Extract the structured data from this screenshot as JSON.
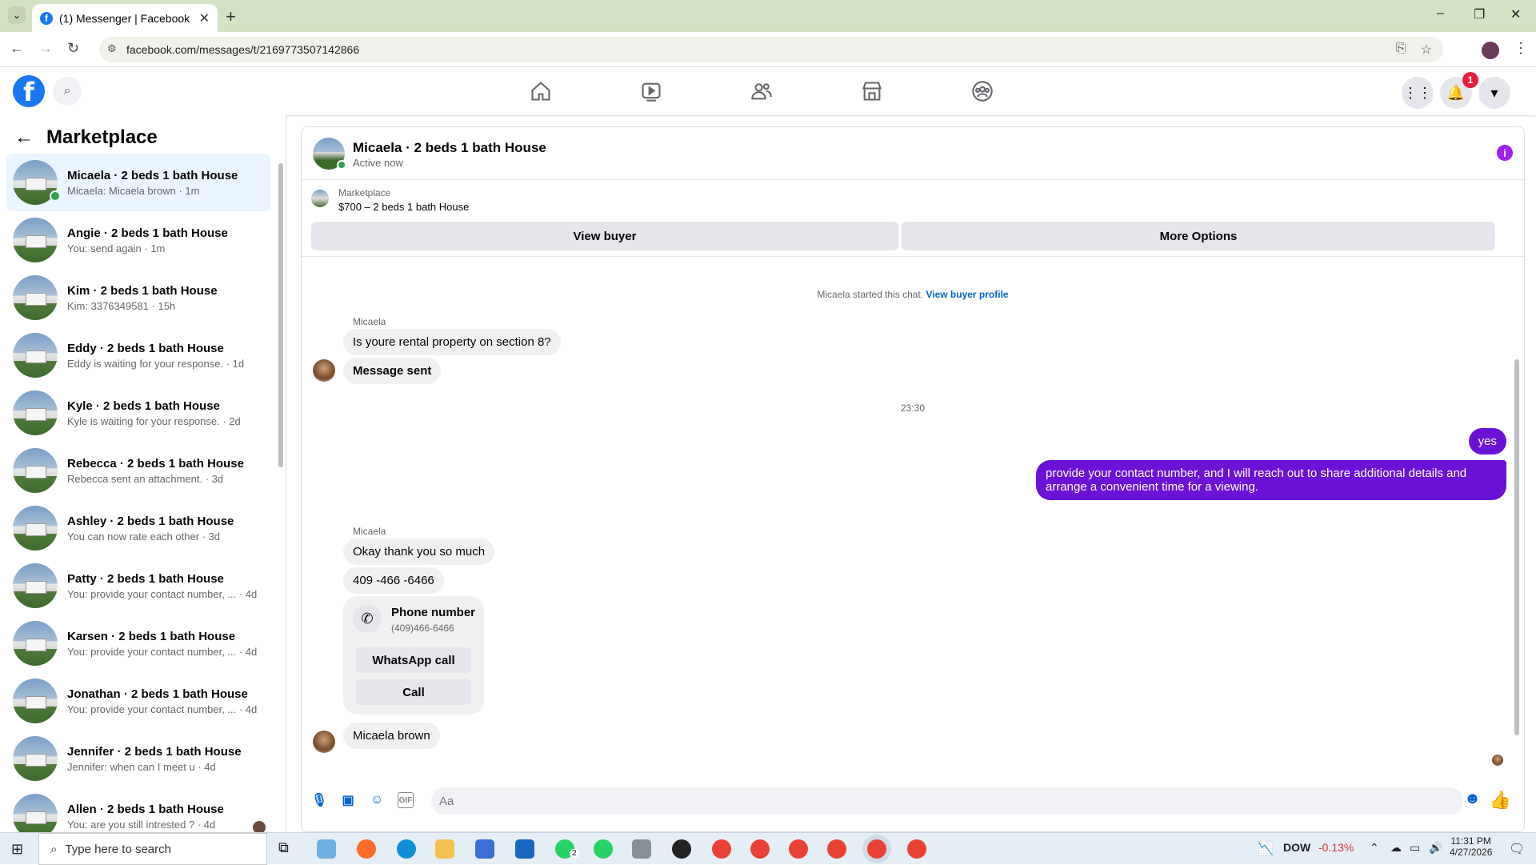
{
  "browser": {
    "tab_title": "(1) Messenger | Facebook",
    "tab_close": "✕",
    "new_tab": "+",
    "url": "facebook.com/messages/t/2169773507142866",
    "window_controls": [
      "–",
      "❐",
      "✕"
    ]
  },
  "fbnav": {
    "logo": "f",
    "notification_count": "1",
    "nav_icons": [
      "home-icon",
      "watch-icon",
      "friends-icon",
      "marketplace-icon",
      "groups-icon"
    ]
  },
  "sidebar": {
    "back": "←",
    "title": "Marketplace",
    "conversations": [
      {
        "name": "Micaela · 2 beds 1 bath House",
        "preview": "Micaela: Micaela brown · 1m"
      },
      {
        "name": "Angie · 2 beds 1 bath House",
        "preview": "You: send again · 1m"
      },
      {
        "name": "Kim · 2 beds 1 bath House",
        "preview": "Kim: 3376349581 · 15h"
      },
      {
        "name": "Eddy · 2 beds 1 bath House",
        "preview": "Eddy is waiting for your response. · 1d"
      },
      {
        "name": "Kyle · 2 beds 1 bath House",
        "preview": "Kyle is waiting for your response. · 2d"
      },
      {
        "name": "Rebecca · 2 beds 1 bath House",
        "preview": "Rebecca sent an attachment. · 3d"
      },
      {
        "name": "Ashley · 2 beds 1 bath House",
        "preview": "You can now rate each other · 3d"
      },
      {
        "name": "Patty · 2 beds 1 bath House",
        "preview": "You: provide your contact number, ... · 4d"
      },
      {
        "name": "Karsen · 2 beds 1 bath House",
        "preview": "You: provide your contact number, ... · 4d"
      },
      {
        "name": "Jonathan · 2 beds 1 bath House",
        "preview": "You: provide your contact number, ... · 4d"
      },
      {
        "name": "Jennifer · 2 beds 1 bath House",
        "preview": "Jennifer: when can I meet u · 4d"
      },
      {
        "name": "Allen · 2 beds 1 bath House",
        "preview": "You: are you still intrested ? · 4d"
      }
    ]
  },
  "chat": {
    "title": "Micaela · 2 beds 1 bath House",
    "status": "Active now",
    "info": "i",
    "marketplace_label": "Marketplace",
    "listing": "$700 – 2 beds 1 bath House",
    "view_buyer": "View buyer",
    "more_options": "More Options",
    "started": "Micaela started this chat.",
    "view_profile": "View buyer profile",
    "sender1": "Micaela",
    "msg1": "Is youre rental property on section 8?",
    "msg2": "Message sent",
    "time": "23:30",
    "me1": "yes",
    "me2": "provide your contact number, and I will reach out to share additional details and arrange a convenient time for a viewing.",
    "sender2": "Micaela",
    "msg3": "Okay thank you so much",
    "msg4": "409 -466 -6466",
    "phone_title": "Phone number",
    "phone_num": "(409)466-6466",
    "whatsapp": "WhatsApp call",
    "call": "Call",
    "msg5": "Micaela brown",
    "placeholder": "Aa"
  },
  "taskbar": {
    "search_placeholder": "Type here to search",
    "stock_name": "DOW",
    "stock_change": "-0.13%",
    "time": "11:31 PM",
    "date": "4/27/2026",
    "whatsapp_badge": "2"
  },
  "colors": {
    "fb_blue": "#1877f2",
    "my_bubble": "#6a12d6",
    "online": "#31a24c",
    "stock_negative": "#d13438"
  }
}
